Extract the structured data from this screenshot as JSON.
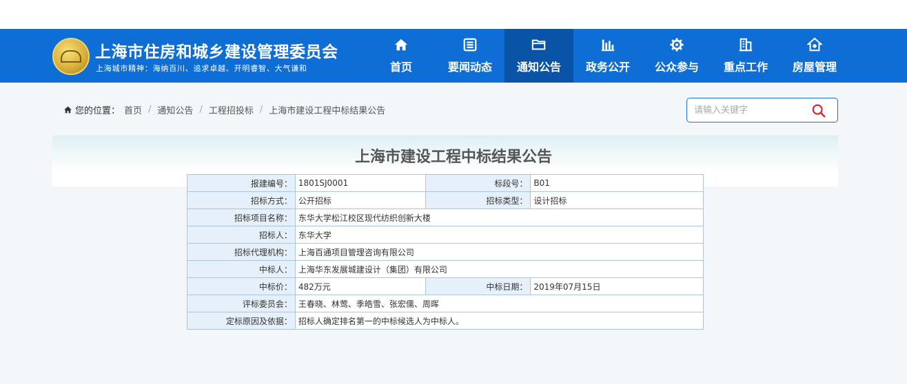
{
  "header": {
    "title": "上海市住房和城乡建设管理委员会",
    "motto": "上海城市精神：海纳百川、追求卓越、开明睿智、大气谦和",
    "nav": [
      {
        "label": "首页",
        "icon": "home-icon"
      },
      {
        "label": "要闻动态",
        "icon": "news-icon"
      },
      {
        "label": "通知公告",
        "icon": "folder-icon",
        "active": true
      },
      {
        "label": "政务公开",
        "icon": "chart-icon"
      },
      {
        "label": "公众参与",
        "icon": "gear-icon"
      },
      {
        "label": "重点工作",
        "icon": "building-icon"
      },
      {
        "label": "房屋管理",
        "icon": "house-icon"
      }
    ]
  },
  "breadcrumb": {
    "prefix": "您的位置：",
    "items": [
      "首页",
      "通知公告",
      "工程招投标",
      "上海市建设工程中标结果公告"
    ]
  },
  "search": {
    "placeholder": "请输入关键字"
  },
  "article": {
    "title": "上海市建设工程中标结果公告",
    "rows": {
      "bid_no_label": "报建编号：",
      "bid_no": "1801SJ0001",
      "section_label": "标段号：",
      "section": "B01",
      "method_label": "招标方式：",
      "method": "公开招标",
      "type_label": "招标类型：",
      "type": "设计招标",
      "project_label": "招标项目名称：",
      "project": "东华大学松江校区现代纺织创新大楼",
      "tenderer_label": "招标人：",
      "tenderer": "东华大学",
      "agency_label": "招标代理机构：",
      "agency": "上海百通项目管理咨询有限公司",
      "winner_label": "中标人：",
      "winner": "上海华东发展城建设计（集团）有限公司",
      "price_label": "中标价：",
      "price": "482万元",
      "date_label": "中标日期：",
      "date": "2019年07月15日",
      "committee_label": "评标委员会：",
      "committee": "王春晓、林莺、季皓雪、张宏儒、周晖",
      "reason_label": "定标原因及依据：",
      "reason": "招标人确定排名第一的中标候选人为中标人。"
    }
  },
  "colors": {
    "header_bg": "#0f6ed6",
    "active_nav": "#0a54a8",
    "label_bg": "#e6f0fa",
    "search_icon": "#d9262b"
  }
}
